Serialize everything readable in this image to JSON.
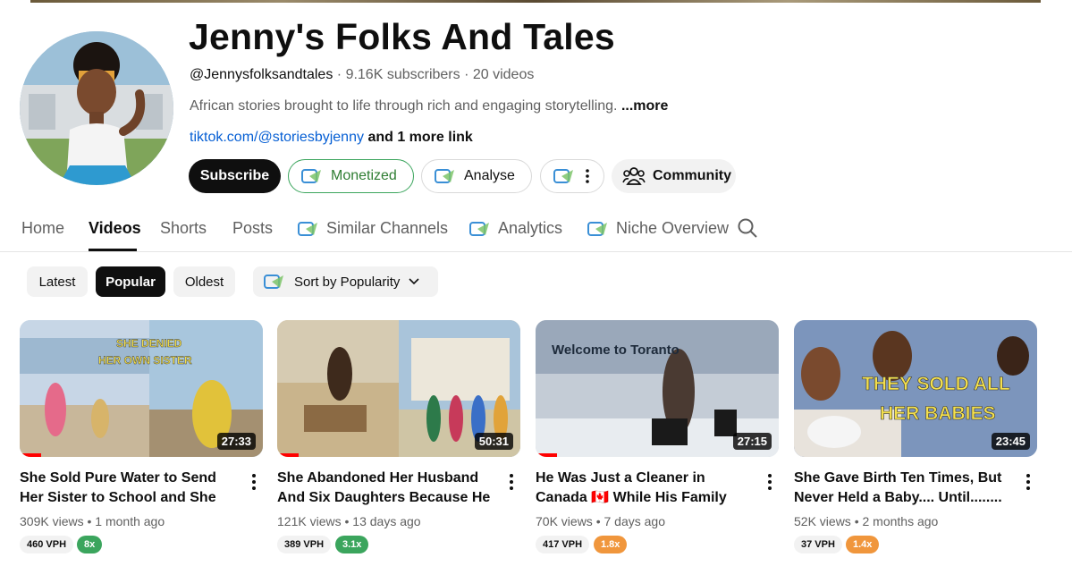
{
  "channel": {
    "name": "Jenny's Folks And Tales",
    "handle": "@Jennysfolksandtales",
    "subscribers": "9.16K subscribers",
    "videos_count": "20 videos",
    "separator": "·",
    "description": "African stories brought to life through rich and engaging storytelling.",
    "description_more": "...more",
    "link": "tiktok.com/@storiesbyjenny",
    "more_links": "and 1 more link"
  },
  "actions": {
    "subscribe": "Subscribe",
    "monetized": "Monetized",
    "analyse": "Analyse",
    "community": "Community"
  },
  "tabs": [
    "Home",
    "Videos",
    "Shorts",
    "Posts",
    "Similar Channels",
    "Analytics",
    "Niche Overview"
  ],
  "active_tab": "Videos",
  "filters": [
    "Latest",
    "Popular",
    "Oldest"
  ],
  "active_filter": "Popular",
  "sort_label": "Sort by Popularity",
  "videos": [
    {
      "title": "She Sold Pure Water to Send Her Sister to School and She Did This t...",
      "duration": "27:33",
      "views": "309K views",
      "age": "1 month ago",
      "vph": "460 VPH",
      "multiplier": "8x",
      "multiplier_color": "#3ba55d",
      "thumb_text": [
        "SHE DENIED",
        "HER OWN SISTER"
      ]
    },
    {
      "title": "She Abandoned Her Husband And Six Daughters Because He Was To...",
      "duration": "50:31",
      "views": "121K views",
      "age": "13 days ago",
      "vph": "389 VPH",
      "multiplier": "3.1x",
      "multiplier_color": "#3ba55d",
      "thumb_text": []
    },
    {
      "title": "He Was Just a Cleaner in Canada 🇨🇦 While His Family Spent...",
      "duration": "27:15",
      "views": "70K views",
      "age": "7 days ago",
      "vph": "417 VPH",
      "multiplier": "1.8x",
      "multiplier_color": "#f0963c",
      "thumb_text": [
        "Welcome to Toranto"
      ]
    },
    {
      "title": "She Gave Birth Ten Times, But Never Held a Baby.... Until........",
      "duration": "23:45",
      "views": "52K views",
      "age": "2 months ago",
      "vph": "37 VPH",
      "multiplier": "1.4x",
      "multiplier_color": "#f0963c",
      "thumb_text": [
        "THEY SOLD ALL",
        "HER BABIES"
      ]
    }
  ],
  "colors": {
    "link": "#065fd4",
    "monetized_border": "#3ba55d",
    "brand_icon": "#3a8fd6"
  }
}
